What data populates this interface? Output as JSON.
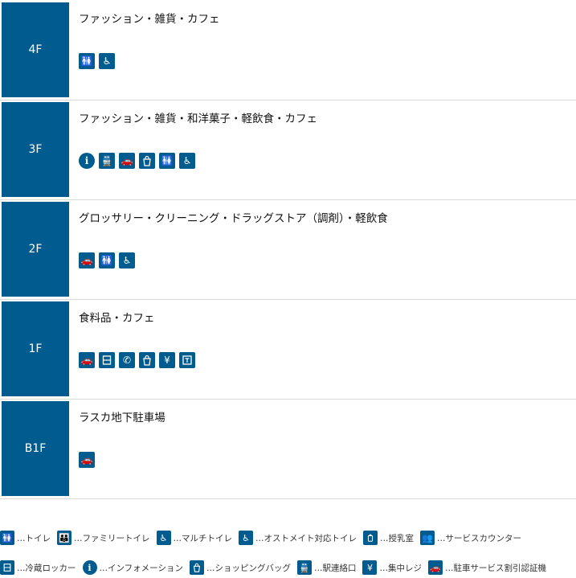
{
  "floors": [
    {
      "label": "4F",
      "desc": "ファッション・雑貨・カフェ",
      "icons": [
        "toilet-icon",
        "ostomate-icon"
      ]
    },
    {
      "label": "3F",
      "desc": "ファッション・雑貨・和洋菓子・軽飲食・カフェ",
      "icons": [
        "information-icon",
        "station-gate-icon",
        "parking-icon",
        "shopping-bag-icon",
        "toilet-icon",
        "multi-toilet-icon"
      ]
    },
    {
      "label": "2F",
      "desc": "グロッサリー・クリーニング・ドラッグストア（調剤）・軽飲食",
      "icons": [
        "parking-icon",
        "toilet-icon",
        "multi-toilet-icon"
      ]
    },
    {
      "label": "1F",
      "desc": "食料品・カフェ",
      "icons": [
        "parking-icon",
        "locker-icon",
        "phone-icon",
        "shopping-bag-icon",
        "yen-icon",
        "atm-icon"
      ]
    },
    {
      "label": "B1F",
      "desc": "ラスカ地下駐車場",
      "icons": [
        "parking-icon"
      ]
    }
  ],
  "legend": {
    "row1": [
      {
        "icon": "toilet-icon",
        "label": "…トイレ"
      },
      {
        "icon": "family-toilet-icon",
        "label": "…ファミリートイレ"
      },
      {
        "icon": "multi-toilet-icon",
        "label": "…マルチトイレ"
      },
      {
        "icon": "ostomate-icon",
        "label": "…オストメイト対応トイレ"
      },
      {
        "icon": "nursing-room-icon",
        "label": "…授乳室"
      },
      {
        "icon": "service-counter-icon",
        "label": "…サービスカウンター"
      }
    ],
    "row2": [
      {
        "icon": "locker-icon",
        "label": "…冷蔵ロッカー"
      },
      {
        "icon": "information-icon",
        "label": "…インフォメーション"
      },
      {
        "icon": "shopping-bag-icon",
        "label": "…ショッピングバッグ"
      },
      {
        "icon": "station-gate-icon",
        "label": "…駅連絡口"
      },
      {
        "icon": "yen-icon",
        "label": "…集中レジ"
      },
      {
        "icon": "parking-icon",
        "label": "…駐車サービス割引認証機"
      }
    ]
  }
}
